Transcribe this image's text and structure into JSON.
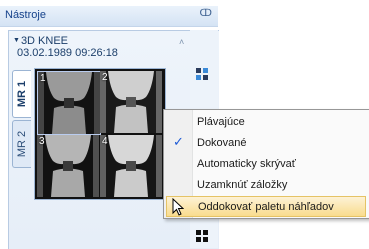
{
  "window": {
    "title": "Nástroje",
    "pin_glyph": "ↀ"
  },
  "series": {
    "name": "3D KNEE",
    "datetime": "03.02.1989 09:26:18"
  },
  "tabs": [
    {
      "label": "MR 1",
      "active": true
    },
    {
      "label": "MR 2",
      "active": false
    }
  ],
  "thumbnails": [
    {
      "number": "1",
      "selected": true
    },
    {
      "number": "2",
      "selected": false
    },
    {
      "number": "3",
      "selected": false
    },
    {
      "number": "4",
      "selected": false
    }
  ],
  "context_menu": {
    "items": [
      {
        "label": "Plávajúce",
        "checked": false
      },
      {
        "label": "Dokované",
        "checked": true
      },
      {
        "label": "Automaticky skrývať",
        "checked": false
      },
      {
        "label": "Uzamknúť záložky",
        "checked": false
      },
      {
        "label": "Oddokovať paletu náhľadov",
        "checked": false,
        "hovered": true
      }
    ],
    "check_glyph": "✓"
  },
  "icons": {
    "scroll_up": "˄",
    "expand": "▼"
  },
  "colors": {
    "menu_hover": "#f9dc8e",
    "check": "#1e5bd6",
    "header_text": "#15428b",
    "tab_border": "#9bb4d3"
  }
}
